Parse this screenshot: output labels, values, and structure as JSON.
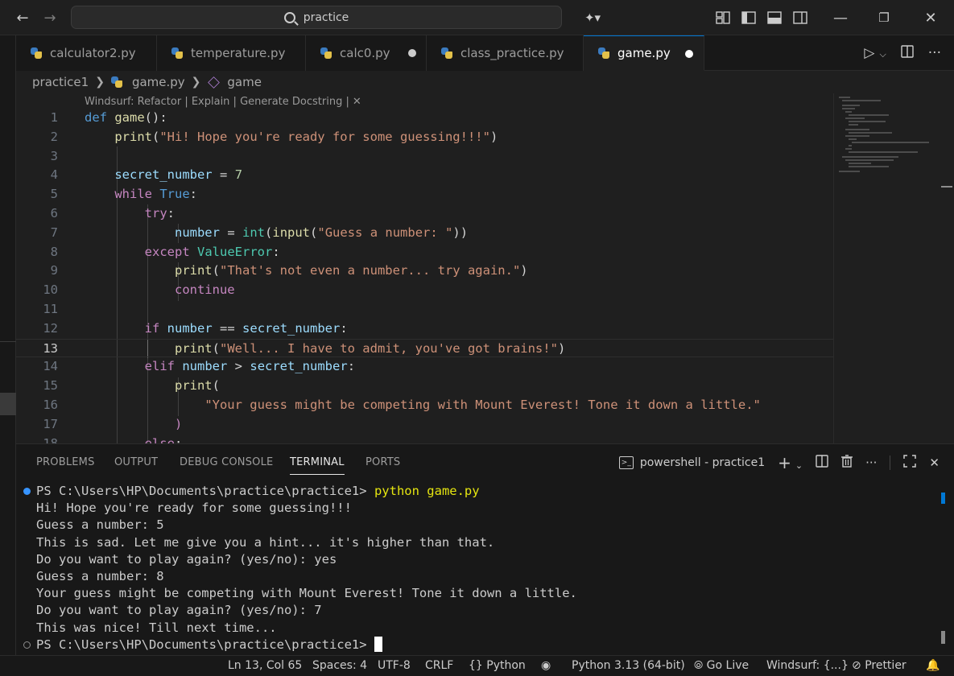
{
  "titlebar": {
    "search_text": "practice"
  },
  "tabs": [
    {
      "label": "calculator2.py",
      "dirty": false,
      "active": false
    },
    {
      "label": "temperature.py",
      "dirty": false,
      "active": false
    },
    {
      "label": "calc0.py",
      "dirty": true,
      "active": false
    },
    {
      "label": "class_practice.py",
      "dirty": false,
      "active": false
    },
    {
      "label": "game.py",
      "dirty": true,
      "active": true
    }
  ],
  "breadcrumb": {
    "folder": "practice1",
    "file": "game.py",
    "symbol": "game"
  },
  "codelens": "Windsurf: Refactor | Explain | Generate Docstring |",
  "editor": {
    "current_line": 13,
    "line_numbers": [
      "1",
      "2",
      "3",
      "4",
      "5",
      "6",
      "7",
      "8",
      "9",
      "10",
      "11",
      "12",
      "13",
      "14",
      "15",
      "16",
      "17",
      "18"
    ]
  },
  "panel": {
    "tabs": [
      "PROBLEMS",
      "OUTPUT",
      "DEBUG CONSOLE",
      "TERMINAL",
      "PORTS"
    ],
    "active_tab": "TERMINAL",
    "shell_label": "powershell - practice1"
  },
  "terminal": {
    "prompt": "PS C:\\Users\\HP\\Documents\\practice\\practice1>",
    "command": "python game.py",
    "output": [
      "Hi! Hope you're ready for some guessing!!!",
      "Guess a number: 5",
      "This is sad. Let me give you a hint... it's higher than that.",
      "Do you want to play again? (yes/no): yes",
      "Guess a number: 8",
      "Your guess might be competing with Mount Everest! Tone it down a little.",
      "Do you want to play again? (yes/no): 7",
      "This was nice! Till next time..."
    ],
    "status_colors": {
      "success": "#3794ff",
      "idle": "#8c8c8c"
    }
  },
  "statusbar": {
    "position": "Ln 13, Col 65",
    "spaces": "Spaces: 4",
    "encoding": "UTF-8",
    "eol": "CRLF",
    "language": "Python",
    "interpreter": "Python 3.13 (64-bit)",
    "golive": "Go Live",
    "windsurf": "Windsurf: {...}",
    "prettier": "Prettier"
  },
  "colors": {
    "accent": "#0078d4",
    "background": "#1f1f1f",
    "keyword": "#569cd6",
    "control": "#c586c0",
    "function": "#dcdcaa",
    "string": "#ce9178",
    "variable": "#9cdcfe",
    "class": "#4ec9b0"
  }
}
